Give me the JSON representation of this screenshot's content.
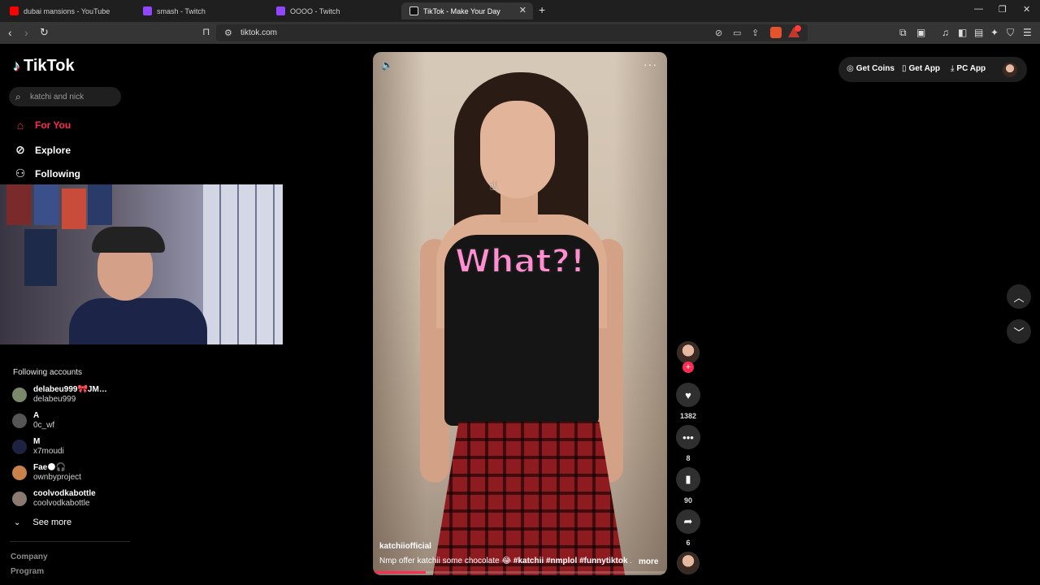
{
  "browser": {
    "tabs": [
      {
        "title": "dubai mansions - YouTube",
        "favicon_color": "#ff0000"
      },
      {
        "title": "smash - Twitch",
        "favicon_color": "#9146ff"
      },
      {
        "title": "OOOO - Twitch",
        "favicon_color": "#9146ff"
      },
      {
        "title": "TikTok - Make Your Day",
        "favicon_color": "#ffffff"
      }
    ],
    "url": "tiktok.com"
  },
  "sidebar": {
    "brand": "TikTok",
    "search_value": "",
    "search_placeholder": "katchi and nick",
    "nav": [
      {
        "label": "For You",
        "icon": "home-icon"
      },
      {
        "label": "Explore",
        "icon": "compass-icon"
      },
      {
        "label": "Following",
        "icon": "user-follow-icon"
      }
    ],
    "following_title": "Following accounts",
    "accounts": [
      {
        "name": "delabeu999🎀JM…",
        "handle": "delabeu999"
      },
      {
        "name": "A",
        "handle": "0c_wf"
      },
      {
        "name": "M",
        "handle": "x7moudi"
      },
      {
        "name": "Fae🌑🎧",
        "handle": "ownbyproject"
      },
      {
        "name": "coolvodkabottle",
        "handle": "coolvodkabottle"
      }
    ],
    "see_more": "See more",
    "footer": [
      "Company",
      "Program"
    ]
  },
  "video": {
    "caption_overlay": "What?!",
    "author": "katchiiofficial",
    "description": "Nmp offer katchii some chocolate 😂",
    "hashtags": [
      "#katchii",
      "#nmplol",
      "#funnytiktok"
    ],
    "ellipsis": "...",
    "more_label": "more",
    "progress": 0.18
  },
  "rail": {
    "likes": "1382",
    "comments": "8",
    "saves": "90",
    "shares": "6"
  },
  "top_actions": {
    "get_coins": "Get Coins",
    "get_app": "Get App",
    "pc_app": "PC App"
  },
  "colors": {
    "accent": "#fe2c55",
    "background": "#000000"
  }
}
